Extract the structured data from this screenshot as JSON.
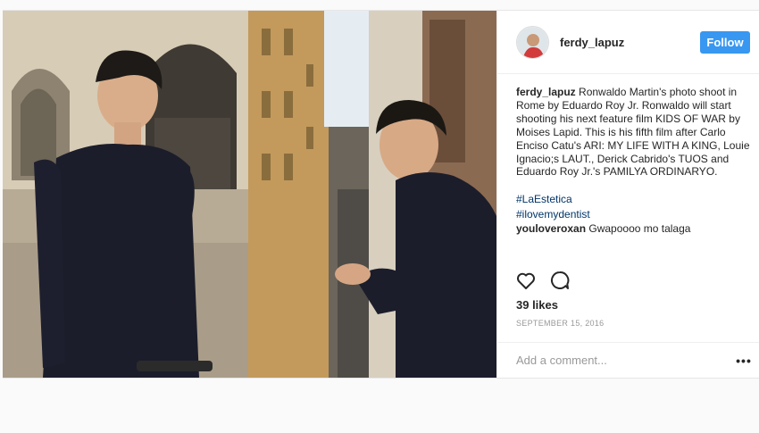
{
  "post": {
    "username": "ferdy_lapuz",
    "follow_label": "Follow",
    "caption": {
      "username": "ferdy_lapuz",
      "text": "Ronwaldo Martin's photo shoot in Rome by Eduardo Roy Jr. Ronwaldo will start shooting his next feature film KIDS OF WAR by Moises Lapid. This is his fifth film after Carlo Enciso Catu's ARI: MY LIFE WITH A KING, Louie Ignacio;s LAUT., Derick Cabrido's TUOS and Eduardo Roy Jr.'s PAMILYA ORDINARYO."
    },
    "hashtags": [
      "#LaEstetica",
      "#ilovemydentist"
    ],
    "comments": [
      {
        "username": "youloveroxan",
        "text": "Gwapoooo mo talaga"
      }
    ],
    "likes": "39 likes",
    "date": "SEPTEMBER 15, 2016",
    "add_comment_placeholder": "Add a comment...",
    "more_label": "•••"
  },
  "icons": [
    "heart-icon",
    "comment-icon",
    "more-options-icon"
  ],
  "colors": {
    "follow_button": "#3897f0",
    "hashtag": "#003569",
    "muted": "#999999"
  }
}
